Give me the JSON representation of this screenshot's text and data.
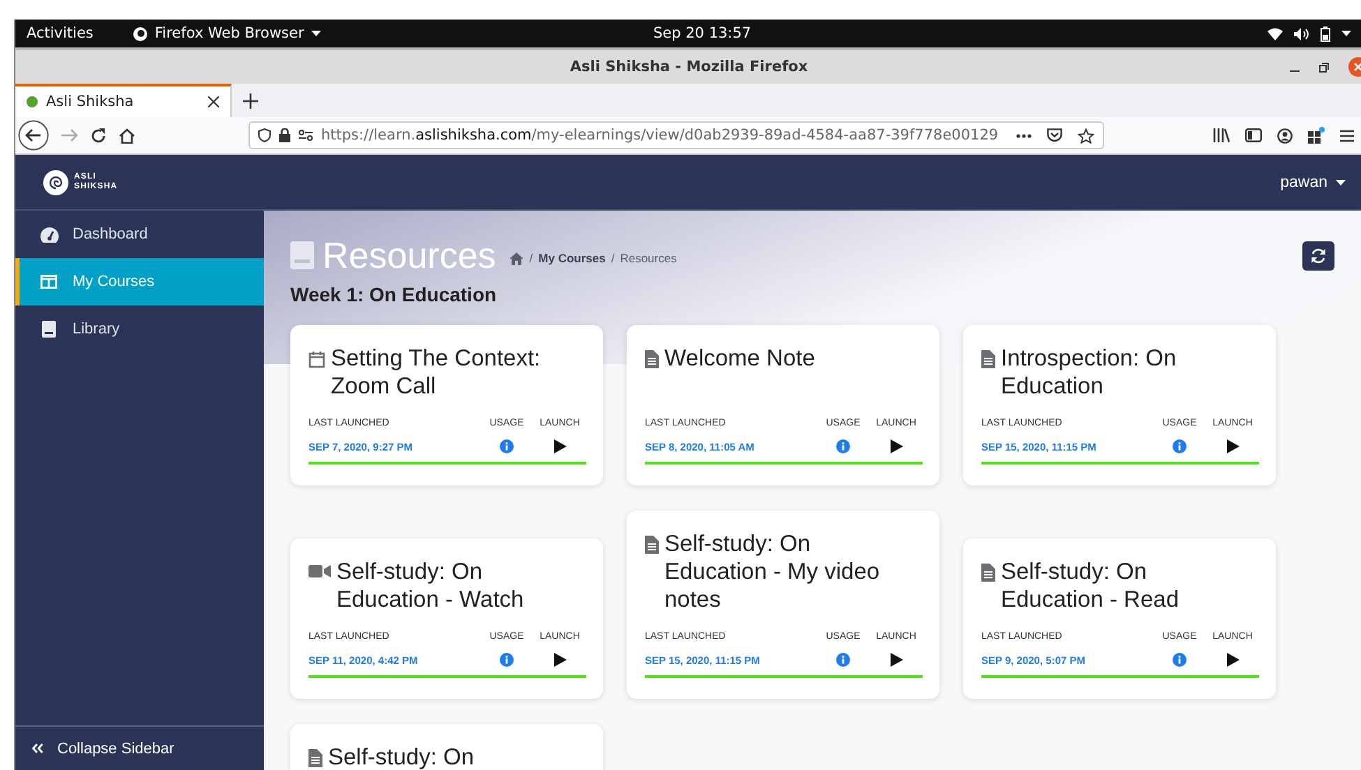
{
  "system_bar": {
    "activities": "Activities",
    "app_menu": "Firefox Web Browser",
    "clock": "Sep 20  13:57"
  },
  "window": {
    "title": "Asli Shiksha - Mozilla Firefox"
  },
  "tabs": [
    {
      "label": "Asli Shiksha",
      "selected": true
    }
  ],
  "address_bar": {
    "prefix": "https://learn.",
    "domain": "aslishiksha.com",
    "path": "/my-elearnings/view/d0ab2939-89ad-4584-aa87-39f778e00129"
  },
  "header": {
    "logo_line1": "ASLI",
    "logo_line2": "SHIKSHA",
    "user": "pawan"
  },
  "sidebar": {
    "items": [
      {
        "label": "Dashboard",
        "kind": "gauge",
        "selected": false
      },
      {
        "label": "My Courses",
        "kind": "columns",
        "selected": true
      },
      {
        "label": "Library",
        "kind": "book",
        "selected": false
      }
    ],
    "collapse": "Collapse Sidebar"
  },
  "page": {
    "title": "Resources",
    "breadcrumb": [
      {
        "separator": "/",
        "label": "My Courses",
        "kind": "link"
      },
      {
        "separator": "/",
        "label": "Resources",
        "kind": "current"
      }
    ],
    "section": "Week 1: On Education"
  },
  "rows": [
    [
      {
        "kind": "calendar",
        "title": "Setting The Context: Zoom Call",
        "last_launched_label": "LAST LAUNCHED",
        "usage_label": "USAGE",
        "launch_label": "LAUNCH",
        "date": "SEP 7, 2020, 9:27 PM",
        "level": 1
      },
      {
        "kind": "document",
        "title": "Welcome Note",
        "last_launched_label": "LAST LAUNCHED",
        "usage_label": "USAGE",
        "launch_label": "LAUNCH",
        "date": "SEP 8, 2020, 11:05 AM",
        "level": 1
      },
      {
        "kind": "document",
        "title": "Introspection: On Education",
        "last_launched_label": "LAST LAUNCHED",
        "usage_label": "USAGE",
        "launch_label": "LAUNCH",
        "date": "SEP 15, 2020, 11:15 PM",
        "level": 1
      }
    ],
    [
      {
        "kind": "video",
        "title": "Self-study: On Education - Watch",
        "last_launched_label": "LAST LAUNCHED",
        "usage_label": "USAGE",
        "launch_label": "LAUNCH",
        "date": "SEP 11, 2020, 4:42 PM",
        "level": 1
      },
      {
        "kind": "document",
        "title": "Self-study: On Education - My video notes",
        "last_launched_label": "LAST LAUNCHED",
        "usage_label": "USAGE",
        "launch_label": "LAUNCH",
        "date": "SEP 15, 2020, 11:15 PM",
        "level": 1
      },
      {
        "kind": "document",
        "title": "Self-study: On Education - Read",
        "last_launched_label": "LAST LAUNCHED",
        "usage_label": "USAGE",
        "launch_label": "LAUNCH",
        "date": "SEP 9, 2020, 5:07 PM",
        "level": 1
      }
    ],
    [
      {
        "kind": "document",
        "title": "Self-study: On"
      }
    ]
  ]
}
